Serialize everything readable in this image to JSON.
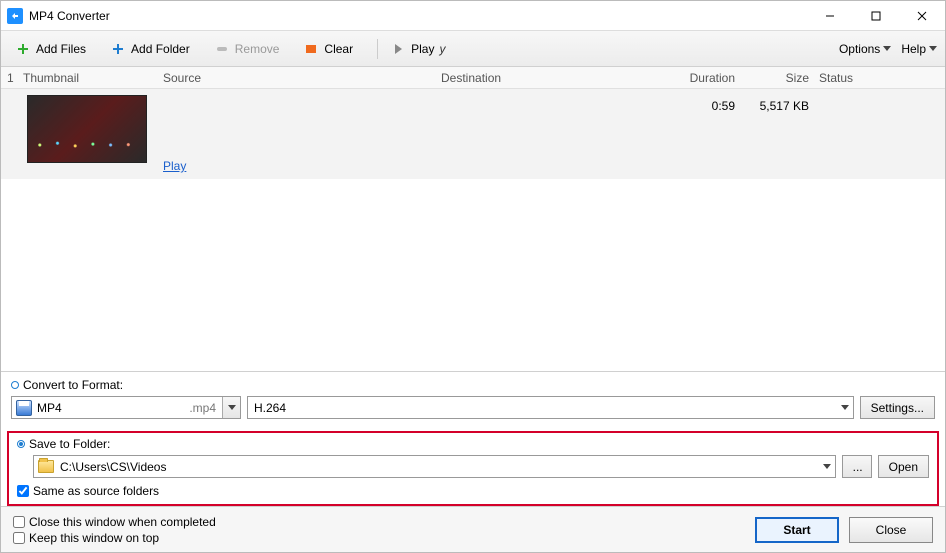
{
  "title": "MP4 Converter",
  "toolbar": {
    "add_files": "Add Files",
    "add_folder": "Add Folder",
    "remove": "Remove",
    "clear": "Clear",
    "play": "Play",
    "play_suffix": "y",
    "options": "Options",
    "help": "Help"
  },
  "columns": {
    "idx": "1",
    "thumbnail": "Thumbnail",
    "source": "Source",
    "destination": "Destination",
    "duration": "Duration",
    "size": "Size",
    "status": "Status"
  },
  "rows": [
    {
      "play_label": "Play",
      "duration": "0:59",
      "size": "5,517 KB"
    }
  ],
  "convert": {
    "label": "Convert to Format:",
    "format": "MP4",
    "ext": ".mp4",
    "codec": "H.264",
    "settings": "Settings..."
  },
  "save": {
    "label": "Save to Folder:",
    "path": "C:\\Users\\CS\\Videos",
    "browse": "...",
    "open": "Open",
    "same_as": "Same as source folders"
  },
  "footer": {
    "close_when_done": "Close this window when completed",
    "keep_on_top": "Keep this window on top",
    "start": "Start",
    "close": "Close"
  }
}
